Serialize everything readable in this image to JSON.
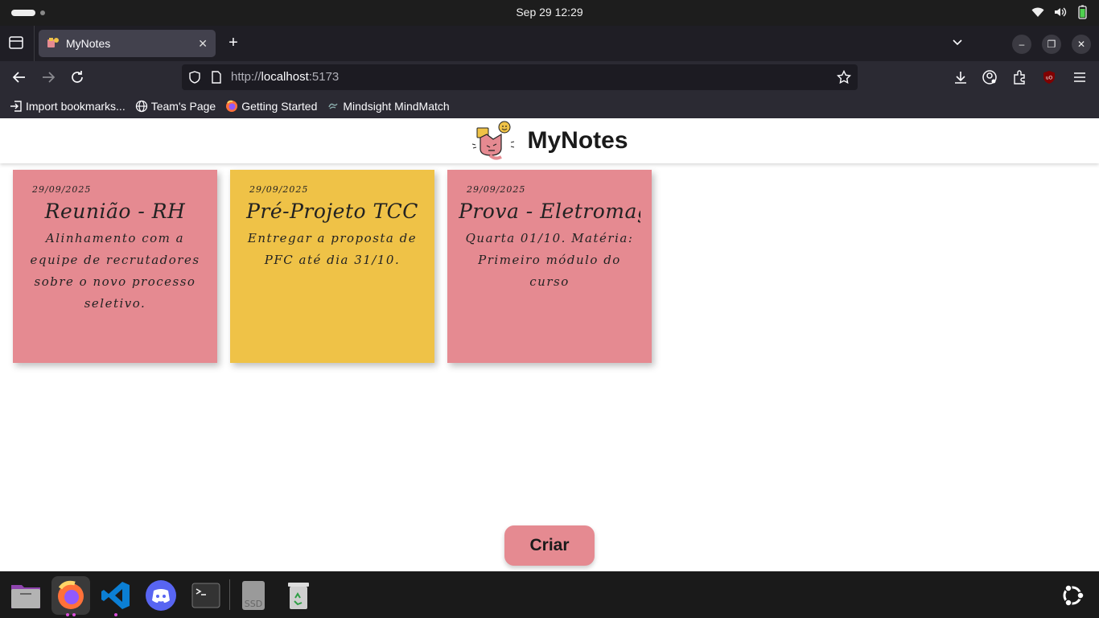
{
  "system": {
    "clock": "Sep 29  12:29"
  },
  "browser": {
    "tab_title": "MyNotes",
    "url_scheme": "http://",
    "url_host": "localhost",
    "url_port": ":5173",
    "bookmarks": [
      {
        "label": "Import bookmarks...",
        "icon": "import-icon"
      },
      {
        "label": "Team's Page",
        "icon": "globe-icon"
      },
      {
        "label": "Getting Started",
        "icon": "firefox-icon"
      },
      {
        "label": "Mindsight MindMatch",
        "icon": "mindsight-icon"
      }
    ]
  },
  "app": {
    "title": "MyNotes",
    "create_label": "Criar",
    "colors": {
      "pink": "#e58a91",
      "yellow": "#efc247",
      "button": "#e58a91"
    },
    "notes": [
      {
        "date": "29/09/2025",
        "title": "Reunião - RH",
        "body": "Alinhamento com a equipe de recrutadores sobre o novo processo seletivo.",
        "color": "#e58a91"
      },
      {
        "date": "29/09/2025",
        "title": "Pré-Projeto TCC",
        "body": "Entregar a proposta de PFC até dia 31/10.",
        "color": "#efc247"
      },
      {
        "date": "29/09/2025",
        "title": "Prova - Eletromag",
        "body": "Quarta 01/10. Matéria: Primeiro módulo do curso",
        "color": "#e58a91"
      }
    ]
  },
  "dock": {
    "items": [
      "files-icon",
      "firefox-icon",
      "vscode-icon",
      "discord-icon",
      "terminal-icon",
      "ssd-drive-icon",
      "trash-icon"
    ],
    "ssd_label": "SSD"
  }
}
